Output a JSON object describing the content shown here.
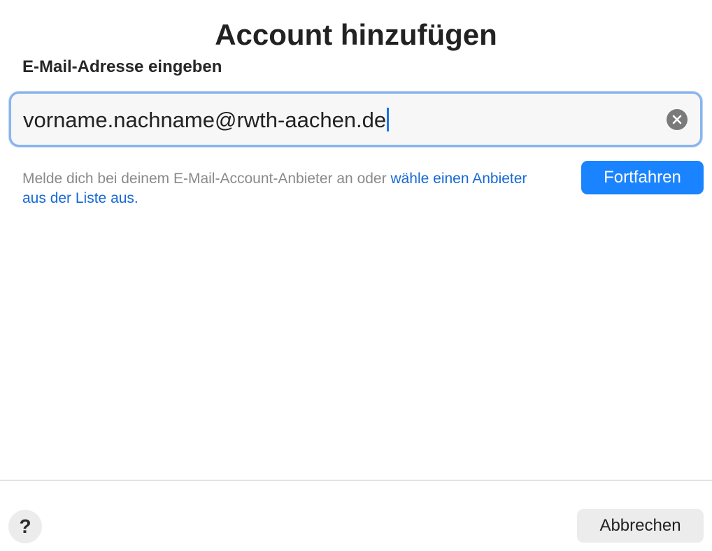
{
  "dialog": {
    "title": "Account hinzufügen",
    "subtitle": "E-Mail-Adresse eingeben"
  },
  "email_input": {
    "value": "vorname.nachname@rwth-aachen.de",
    "clear_icon": "clear-icon"
  },
  "hint": {
    "text": "Melde dich bei deinem E-Mail-Account-Anbieter an oder ",
    "link_text": "wähle einen Anbieter aus der Liste aus."
  },
  "buttons": {
    "continue_label": "Fortfahren",
    "help_label": "?",
    "cancel_label": "Abbrechen"
  },
  "colors": {
    "accent": "#1a83ff",
    "link": "#1568d6",
    "focus_ring": "#87b4ee"
  }
}
